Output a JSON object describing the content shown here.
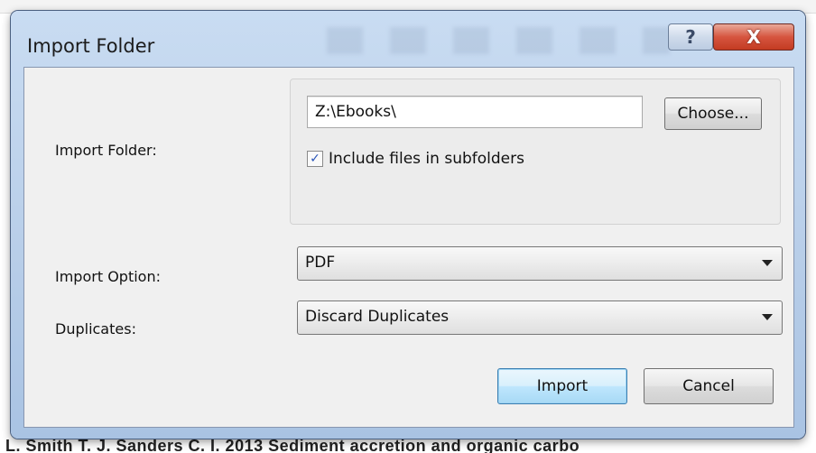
{
  "dialog": {
    "title": "Import Folder",
    "help_glyph": "?",
    "close_glyph": "X"
  },
  "folder": {
    "label": "Import Folder:",
    "value": "Z:\\Ebooks\\",
    "choose_label": "Choose...",
    "include_subfolders_label": "Include files in subfolders",
    "include_subfolders_checked": true
  },
  "import_option": {
    "label": "Import Option:",
    "selected": "PDF"
  },
  "duplicates": {
    "label": "Duplicates:",
    "selected": "Discard Duplicates"
  },
  "buttons": {
    "import_label": "Import",
    "cancel_label": "Cancel"
  },
  "background": {
    "bottom_text": "L. Smith T. J. Sanders C. I.        2013      Sediment accretion and organic carbo"
  },
  "icons": {
    "checkmark": "check-icon",
    "dropdown": "chevron-down-icon"
  }
}
